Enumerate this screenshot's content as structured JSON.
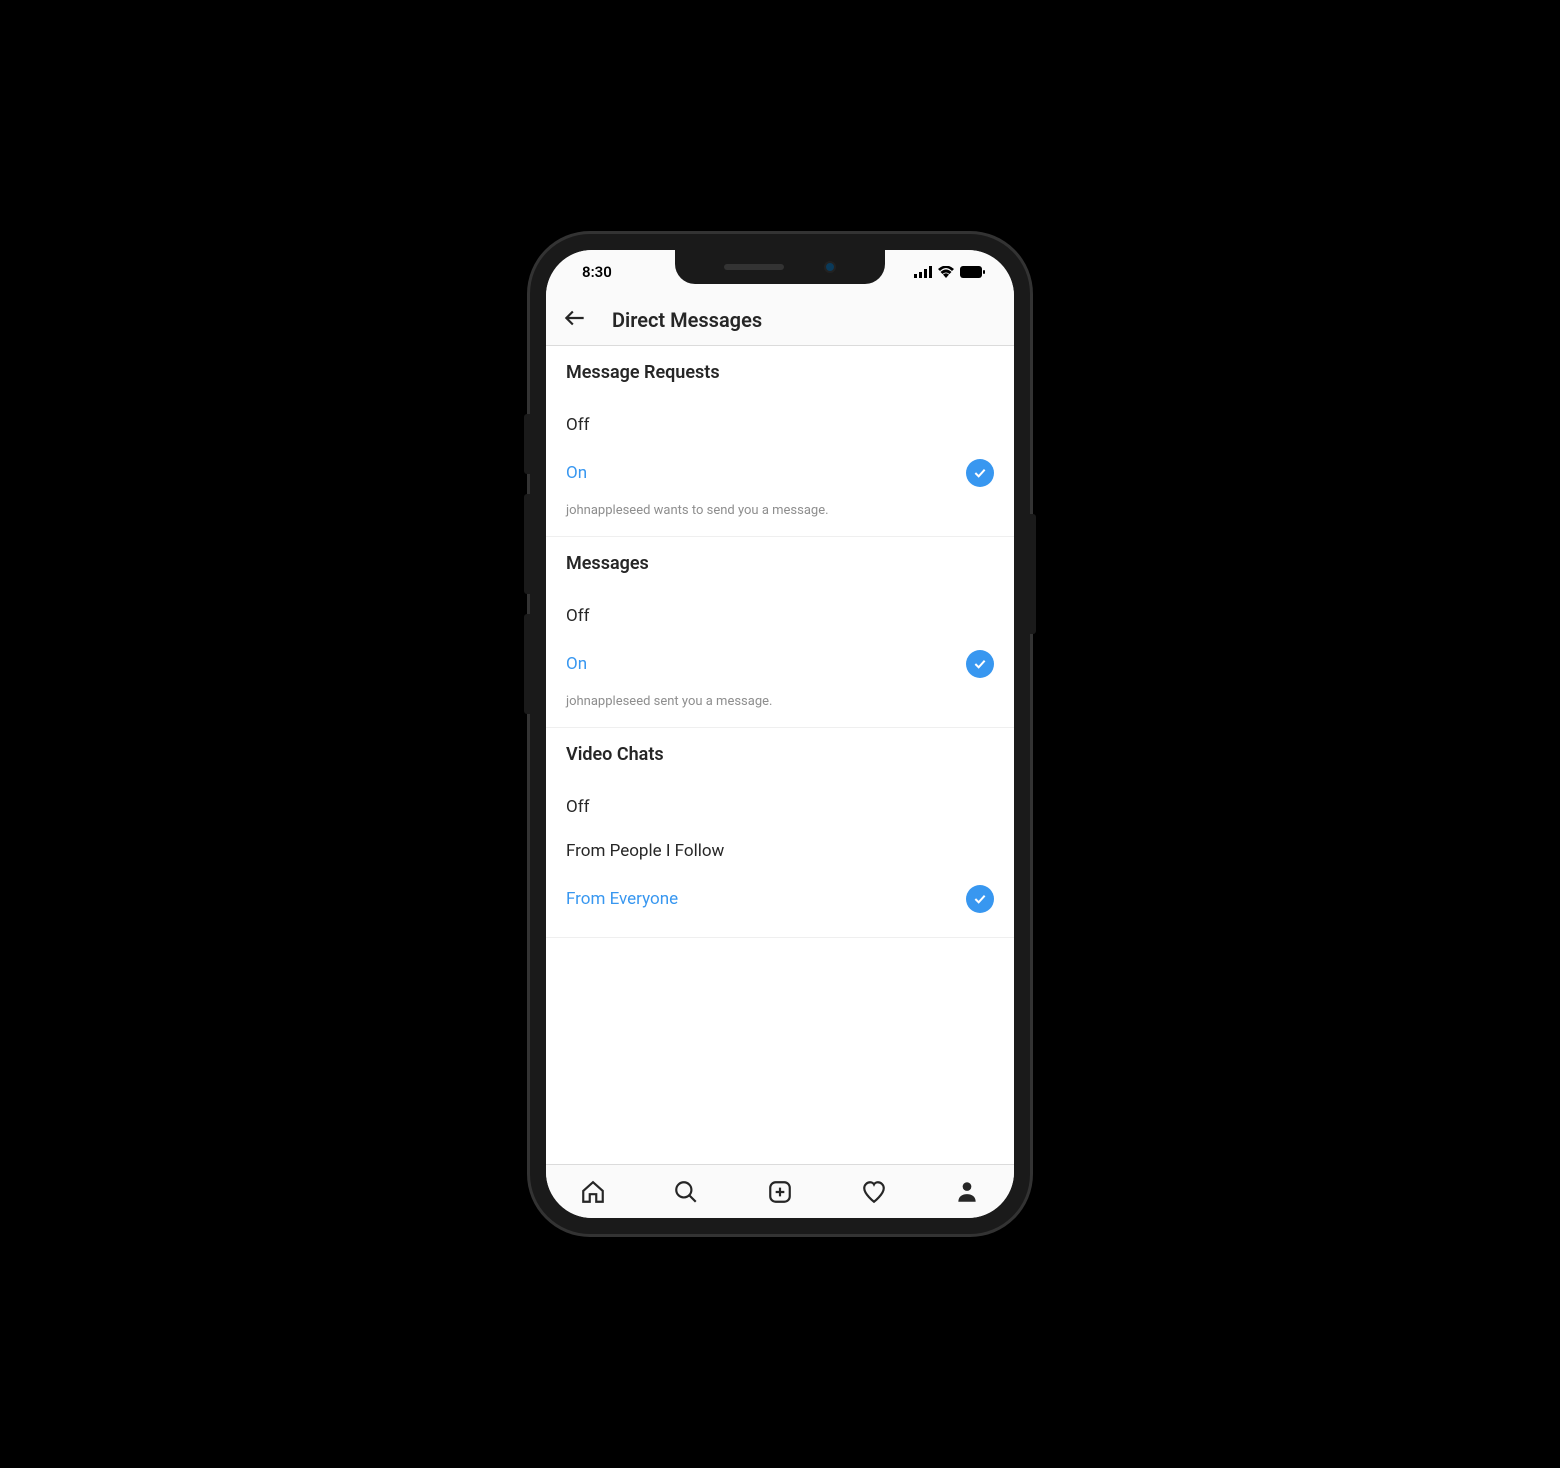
{
  "status": {
    "time": "8:30"
  },
  "header": {
    "title": "Direct Messages"
  },
  "sections": [
    {
      "title": "Message Requests",
      "options": [
        {
          "label": "Off",
          "selected": false
        },
        {
          "label": "On",
          "selected": true
        }
      ],
      "note": "johnappleseed wants to send you a message."
    },
    {
      "title": "Messages",
      "options": [
        {
          "label": "Off",
          "selected": false
        },
        {
          "label": "On",
          "selected": true
        }
      ],
      "note": "johnappleseed sent you a message."
    },
    {
      "title": "Video Chats",
      "options": [
        {
          "label": "Off",
          "selected": false
        },
        {
          "label": "From People I Follow",
          "selected": false
        },
        {
          "label": "From Everyone",
          "selected": true
        }
      ],
      "note": ""
    }
  ]
}
